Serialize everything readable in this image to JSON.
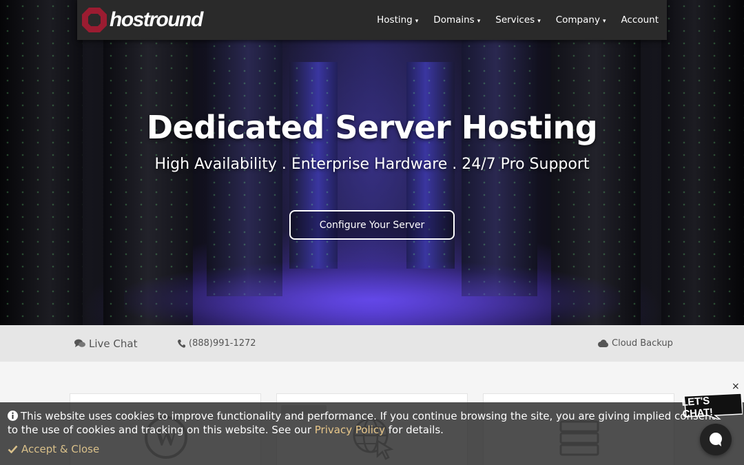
{
  "brand": {
    "name": "hostround",
    "accent": "#9b1c31"
  },
  "nav": {
    "items": [
      {
        "label": "Hosting",
        "caret": true
      },
      {
        "label": "Domains",
        "caret": true
      },
      {
        "label": "Services",
        "caret": true
      },
      {
        "label": "Company",
        "caret": true
      },
      {
        "label": "Account",
        "caret": false
      }
    ]
  },
  "hero": {
    "title": "Dedicated Server Hosting",
    "subtitle": "High Availability . Enterprise Hardware . 24/7 Pro Support",
    "cta": "Configure Your Server"
  },
  "infobar": {
    "live_chat": "Live Chat",
    "phone": "(888)991-1272",
    "cloud_backup": "Cloud Backup"
  },
  "cards": [
    {
      "icon": "wordpress-icon"
    },
    {
      "icon": "globe-cursor-icon"
    },
    {
      "icon": "server-icon"
    }
  ],
  "cookie": {
    "text_before": "This website uses cookies to improve functionality and performance. If you continue browsing the site, you are giving implied consent to the use of cookies and tracking on this website. See our ",
    "link": "Privacy Policy",
    "text_after": " for details.",
    "accept": "Accept & Close"
  },
  "chat": {
    "badge": "LET'S CHAT!",
    "close": "×"
  }
}
